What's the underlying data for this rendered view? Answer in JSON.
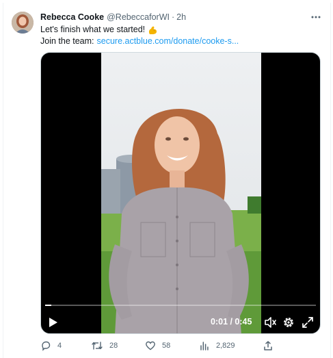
{
  "tweet": {
    "author_name": "Rebecca Cooke",
    "handle": "@RebeccaforWI",
    "separator": "·",
    "time": "2h",
    "text_line1": "Let's finish what we started!",
    "emoji_icon": "flexed-biceps-icon",
    "text_line2_prefix": "Join the team:",
    "link_text": "secure.actblue.com/donate/cooke-s..."
  },
  "video": {
    "timecode": "0:01 / 0:45",
    "progress_fraction": 0.022
  },
  "actions": {
    "replies": "4",
    "reposts": "28",
    "likes": "58",
    "views": "2,829"
  },
  "colors": {
    "link": "#1d9bf0",
    "muted": "#536471",
    "text": "#0f1419"
  }
}
